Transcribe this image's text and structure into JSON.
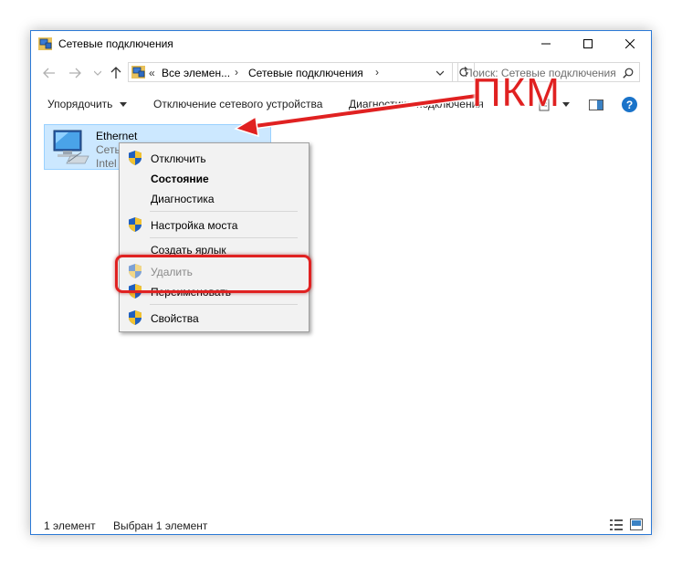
{
  "window": {
    "title": "Сетевые подключения",
    "accent_color": "#2b79d6"
  },
  "address": {
    "prefix": "«",
    "crumb1": "Все элемен...",
    "crumb2": "Сетевые подключения",
    "search_placeholder": "Поиск: Сетевые подключения"
  },
  "toolbar": {
    "organize": "Упорядочить",
    "disable_device": "Отключение сетевого устройства",
    "diagnostics": "Диагностика",
    "rename": "подключения"
  },
  "item": {
    "name": "Ethernet",
    "line2": "Сеть",
    "line3": "Intel"
  },
  "context_menu": {
    "disable": "Отключить",
    "status": "Состояние",
    "diagnose": "Диагностика",
    "bridge": "Настройка моста",
    "shortcut": "Создать ярлык",
    "delete": "Удалить",
    "rename": "Переименовать",
    "properties": "Свойства"
  },
  "annotation": {
    "label": "ПКМ",
    "color": "#e02121"
  },
  "statusbar": {
    "count": "1 элемент",
    "selected": "Выбран 1 элемент"
  }
}
